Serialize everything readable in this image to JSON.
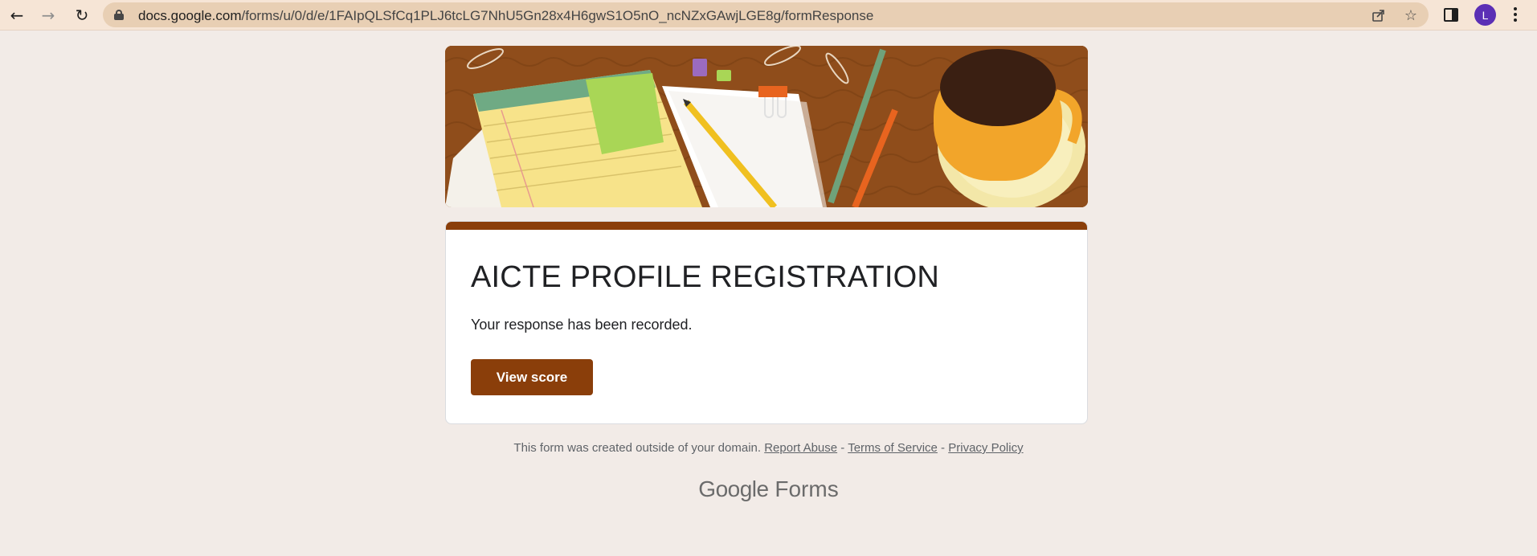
{
  "browser": {
    "url_host": "docs.google.com",
    "url_path": "/forms/u/0/d/e/1FAIpQLSfCq1PLJ6tcLG7NhU5Gn28x4H6gwS1O5nO_ncNZxGAwjLGE8g/formResponse",
    "avatar_initial": "L",
    "icons": [
      "back-icon",
      "forward-icon",
      "reload-icon",
      "lock-icon",
      "share-icon",
      "star-icon",
      "side-panel-icon",
      "more-menu-icon"
    ]
  },
  "form": {
    "title": "AICTE PROFILE REGISTRATION",
    "confirmation": "Your response has been recorded.",
    "view_score_label": "View score",
    "accent_color": "#8a3e0a"
  },
  "footer": {
    "notice": "This form was created outside of your domain.",
    "report_abuse": "Report Abuse",
    "separator": " - ",
    "terms": "Terms of Service",
    "privacy": "Privacy Policy",
    "logo_google": "Google",
    "logo_forms": "Forms"
  }
}
